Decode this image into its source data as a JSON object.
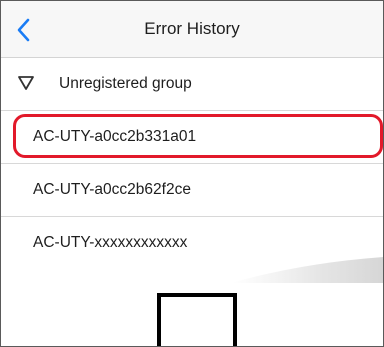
{
  "navbar": {
    "title": "Error History",
    "back_icon": "chevron-left-icon",
    "accent_color": "#1a7cf5"
  },
  "group": {
    "label": "Unregistered group",
    "icon": "triangle-down-icon"
  },
  "devices": [
    {
      "label": "AC-UTY-a0cc2b331a01",
      "highlighted": true
    },
    {
      "label": "AC-UTY-a0cc2b62f2ce",
      "highlighted": false
    },
    {
      "label": "AC-UTY-xxxxxxxxxxxx",
      "highlighted": false
    }
  ],
  "highlight_color": "#e2192a"
}
